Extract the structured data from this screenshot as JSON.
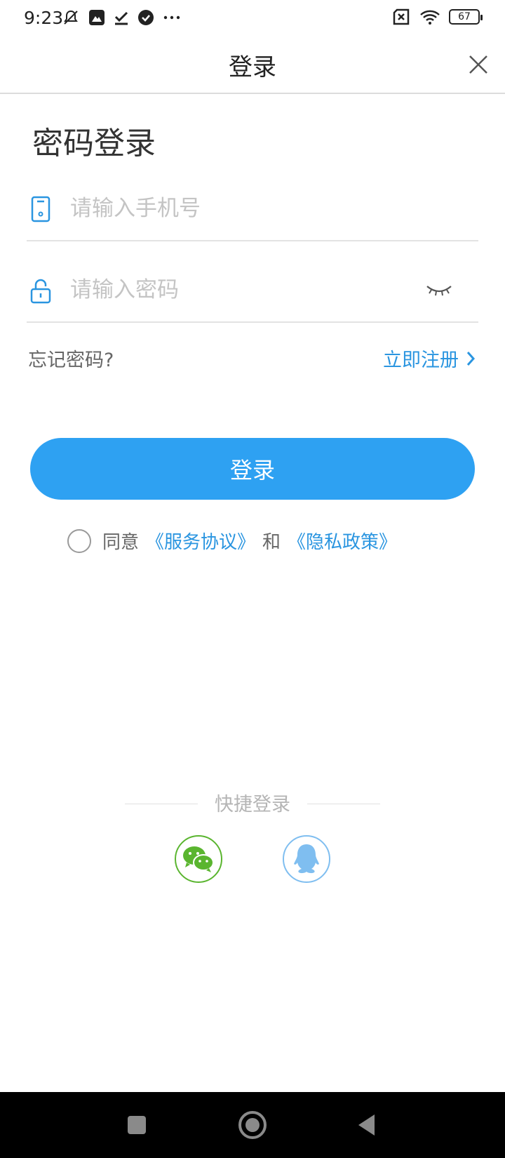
{
  "status_bar": {
    "time": "9:23",
    "battery": "67"
  },
  "title_bar": {
    "title": "登录"
  },
  "heading": "密码登录",
  "phone_field": {
    "placeholder": "请输入手机号",
    "value": ""
  },
  "password_field": {
    "placeholder": "请输入密码",
    "value": ""
  },
  "links": {
    "forgot": "忘记密码?",
    "register": "立即注册"
  },
  "login_button": "登录",
  "agreement": {
    "prefix": "同意",
    "service": "《服务协议》",
    "and": "和",
    "privacy": "《隐私政策》"
  },
  "quick_login": {
    "label": "快捷登录",
    "providers": [
      "wechat-icon",
      "qq-icon"
    ]
  },
  "colors": {
    "accent": "#2ea1f2",
    "link": "#2a95e0",
    "wechat": "#5ab52f",
    "qq": "#7fbef0"
  }
}
